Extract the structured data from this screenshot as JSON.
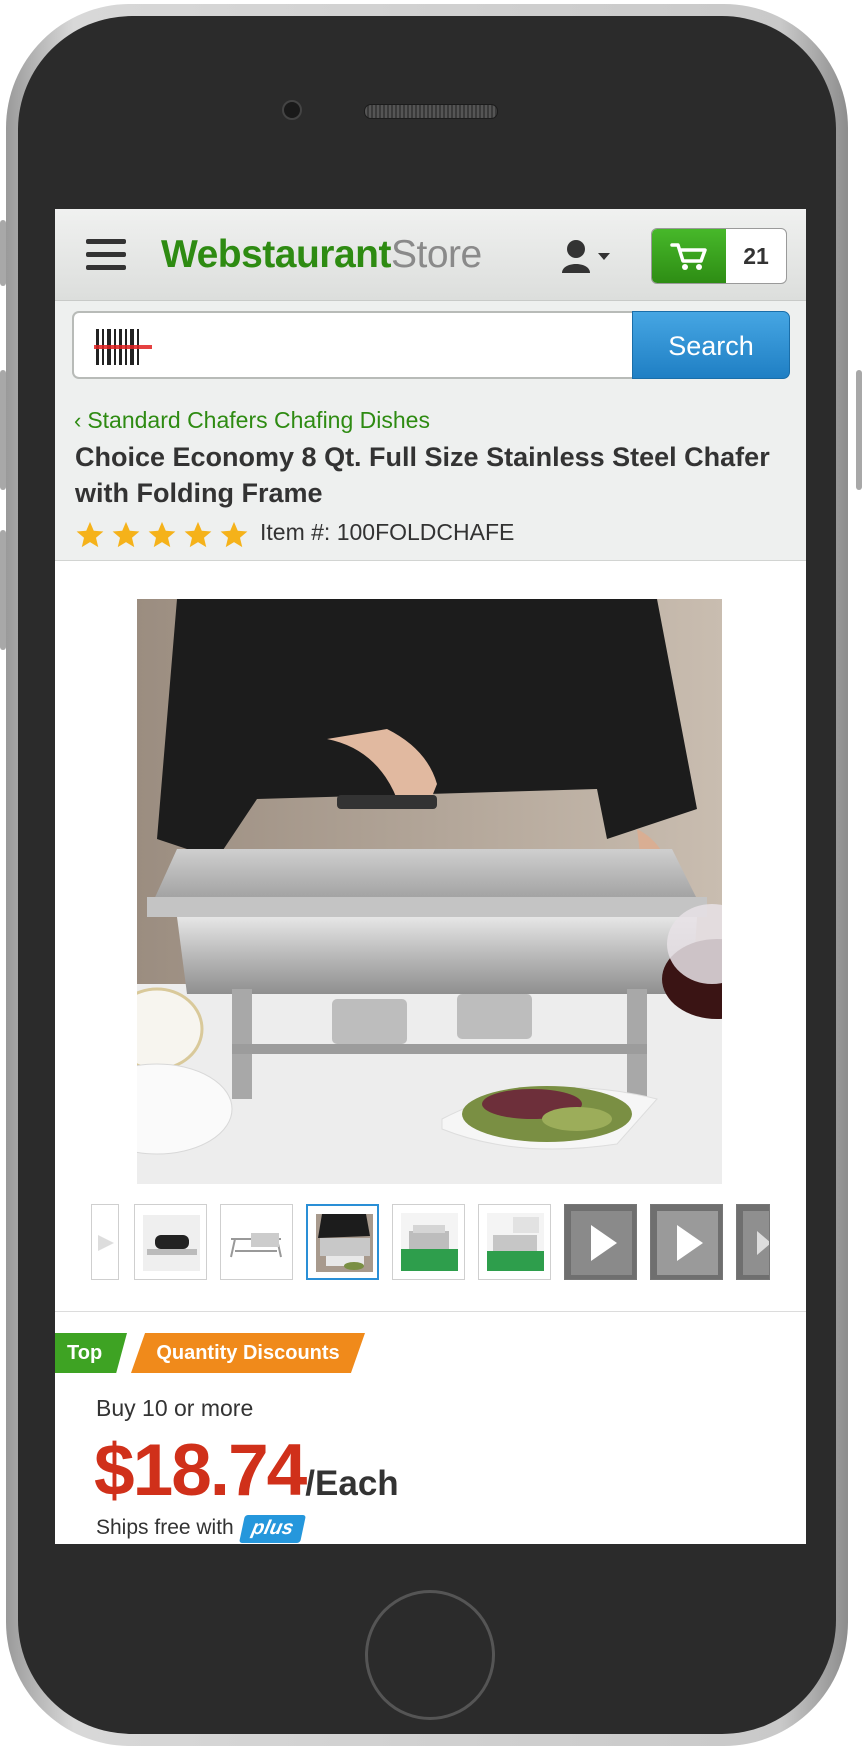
{
  "header": {
    "logo_bold": "Webstaurant",
    "logo_light": "Store",
    "cart_count": "21"
  },
  "search": {
    "button_label": "Search",
    "placeholder": ""
  },
  "product": {
    "breadcrumb": "Standard Chafers Chafing Dishes",
    "title": "Choice Economy 8 Qt. Full Size Stainless Steel Chafer with Folding Frame",
    "rating_stars": 5,
    "item_number": "Item #: 100FOLDCHAFE"
  },
  "thumbnails": [
    {
      "name": "thumb-partial",
      "kind": "image"
    },
    {
      "name": "thumb-handle",
      "kind": "image"
    },
    {
      "name": "thumb-frame",
      "kind": "image"
    },
    {
      "name": "thumb-chef",
      "kind": "image",
      "selected": true
    },
    {
      "name": "thumb-chafer-green",
      "kind": "image"
    },
    {
      "name": "thumb-chafer-open",
      "kind": "image"
    },
    {
      "name": "thumb-video-1",
      "kind": "video"
    },
    {
      "name": "thumb-video-2",
      "kind": "video"
    },
    {
      "name": "thumb-video-partial",
      "kind": "video"
    }
  ],
  "tags": {
    "top": "Top",
    "quantity_discounts": "Quantity Discounts"
  },
  "pricing": {
    "buy_label": "Buy 10 or more",
    "price": "$18.74",
    "unit": "/Each",
    "ships_free": "Ships free with",
    "plus_badge": "plus"
  },
  "colors": {
    "brand_green": "#2e8b12",
    "search_blue": "#1f7fc4",
    "price_red": "#d0301a",
    "tag_orange": "#f08a1b"
  }
}
